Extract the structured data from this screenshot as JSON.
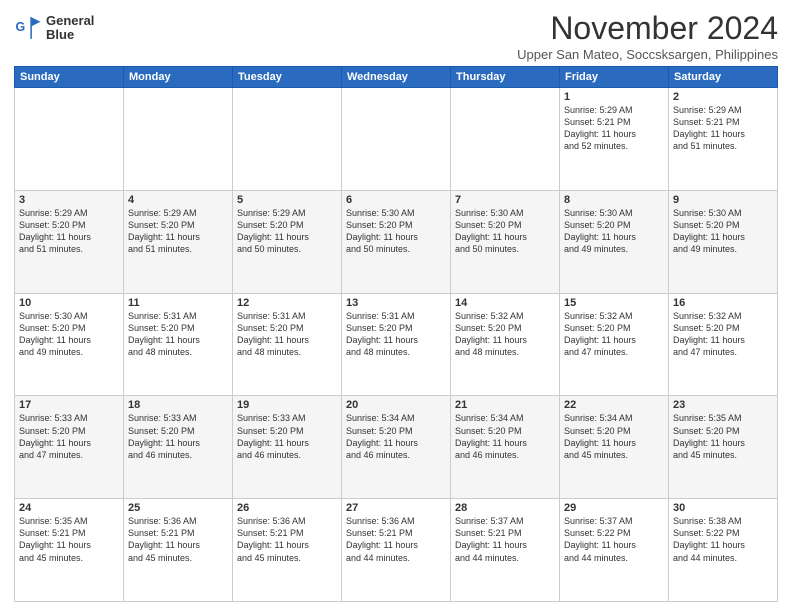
{
  "logo": {
    "line1": "General",
    "line2": "Blue"
  },
  "header": {
    "month": "November 2024",
    "location": "Upper San Mateo, Soccsksargen, Philippines"
  },
  "weekdays": [
    "Sunday",
    "Monday",
    "Tuesday",
    "Wednesday",
    "Thursday",
    "Friday",
    "Saturday"
  ],
  "weeks": [
    [
      {
        "day": "",
        "info": ""
      },
      {
        "day": "",
        "info": ""
      },
      {
        "day": "",
        "info": ""
      },
      {
        "day": "",
        "info": ""
      },
      {
        "day": "",
        "info": ""
      },
      {
        "day": "1",
        "info": "Sunrise: 5:29 AM\nSunset: 5:21 PM\nDaylight: 11 hours\nand 52 minutes."
      },
      {
        "day": "2",
        "info": "Sunrise: 5:29 AM\nSunset: 5:21 PM\nDaylight: 11 hours\nand 51 minutes."
      }
    ],
    [
      {
        "day": "3",
        "info": "Sunrise: 5:29 AM\nSunset: 5:20 PM\nDaylight: 11 hours\nand 51 minutes."
      },
      {
        "day": "4",
        "info": "Sunrise: 5:29 AM\nSunset: 5:20 PM\nDaylight: 11 hours\nand 51 minutes."
      },
      {
        "day": "5",
        "info": "Sunrise: 5:29 AM\nSunset: 5:20 PM\nDaylight: 11 hours\nand 50 minutes."
      },
      {
        "day": "6",
        "info": "Sunrise: 5:30 AM\nSunset: 5:20 PM\nDaylight: 11 hours\nand 50 minutes."
      },
      {
        "day": "7",
        "info": "Sunrise: 5:30 AM\nSunset: 5:20 PM\nDaylight: 11 hours\nand 50 minutes."
      },
      {
        "day": "8",
        "info": "Sunrise: 5:30 AM\nSunset: 5:20 PM\nDaylight: 11 hours\nand 49 minutes."
      },
      {
        "day": "9",
        "info": "Sunrise: 5:30 AM\nSunset: 5:20 PM\nDaylight: 11 hours\nand 49 minutes."
      }
    ],
    [
      {
        "day": "10",
        "info": "Sunrise: 5:30 AM\nSunset: 5:20 PM\nDaylight: 11 hours\nand 49 minutes."
      },
      {
        "day": "11",
        "info": "Sunrise: 5:31 AM\nSunset: 5:20 PM\nDaylight: 11 hours\nand 48 minutes."
      },
      {
        "day": "12",
        "info": "Sunrise: 5:31 AM\nSunset: 5:20 PM\nDaylight: 11 hours\nand 48 minutes."
      },
      {
        "day": "13",
        "info": "Sunrise: 5:31 AM\nSunset: 5:20 PM\nDaylight: 11 hours\nand 48 minutes."
      },
      {
        "day": "14",
        "info": "Sunrise: 5:32 AM\nSunset: 5:20 PM\nDaylight: 11 hours\nand 48 minutes."
      },
      {
        "day": "15",
        "info": "Sunrise: 5:32 AM\nSunset: 5:20 PM\nDaylight: 11 hours\nand 47 minutes."
      },
      {
        "day": "16",
        "info": "Sunrise: 5:32 AM\nSunset: 5:20 PM\nDaylight: 11 hours\nand 47 minutes."
      }
    ],
    [
      {
        "day": "17",
        "info": "Sunrise: 5:33 AM\nSunset: 5:20 PM\nDaylight: 11 hours\nand 47 minutes."
      },
      {
        "day": "18",
        "info": "Sunrise: 5:33 AM\nSunset: 5:20 PM\nDaylight: 11 hours\nand 46 minutes."
      },
      {
        "day": "19",
        "info": "Sunrise: 5:33 AM\nSunset: 5:20 PM\nDaylight: 11 hours\nand 46 minutes."
      },
      {
        "day": "20",
        "info": "Sunrise: 5:34 AM\nSunset: 5:20 PM\nDaylight: 11 hours\nand 46 minutes."
      },
      {
        "day": "21",
        "info": "Sunrise: 5:34 AM\nSunset: 5:20 PM\nDaylight: 11 hours\nand 46 minutes."
      },
      {
        "day": "22",
        "info": "Sunrise: 5:34 AM\nSunset: 5:20 PM\nDaylight: 11 hours\nand 45 minutes."
      },
      {
        "day": "23",
        "info": "Sunrise: 5:35 AM\nSunset: 5:20 PM\nDaylight: 11 hours\nand 45 minutes."
      }
    ],
    [
      {
        "day": "24",
        "info": "Sunrise: 5:35 AM\nSunset: 5:21 PM\nDaylight: 11 hours\nand 45 minutes."
      },
      {
        "day": "25",
        "info": "Sunrise: 5:36 AM\nSunset: 5:21 PM\nDaylight: 11 hours\nand 45 minutes."
      },
      {
        "day": "26",
        "info": "Sunrise: 5:36 AM\nSunset: 5:21 PM\nDaylight: 11 hours\nand 45 minutes."
      },
      {
        "day": "27",
        "info": "Sunrise: 5:36 AM\nSunset: 5:21 PM\nDaylight: 11 hours\nand 44 minutes."
      },
      {
        "day": "28",
        "info": "Sunrise: 5:37 AM\nSunset: 5:21 PM\nDaylight: 11 hours\nand 44 minutes."
      },
      {
        "day": "29",
        "info": "Sunrise: 5:37 AM\nSunset: 5:22 PM\nDaylight: 11 hours\nand 44 minutes."
      },
      {
        "day": "30",
        "info": "Sunrise: 5:38 AM\nSunset: 5:22 PM\nDaylight: 11 hours\nand 44 minutes."
      }
    ]
  ]
}
